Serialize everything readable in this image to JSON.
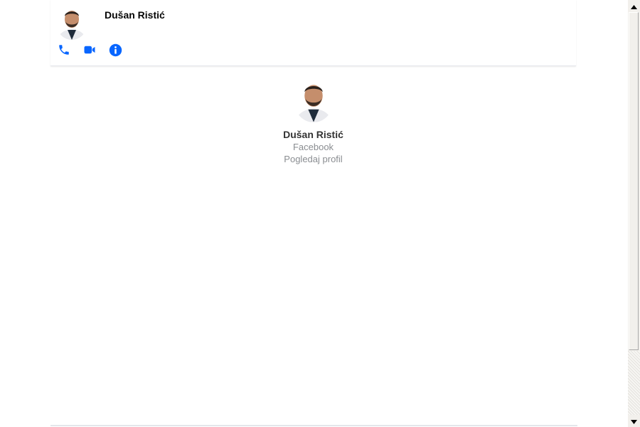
{
  "conversation": {
    "contact_name": "Dušan Ristić"
  },
  "header": {
    "actions": [
      {
        "icon": "phone-icon",
        "color": "#0866ff"
      },
      {
        "icon": "video-camera-icon",
        "color": "#0866ff"
      },
      {
        "icon": "info-icon",
        "color": "#0866ff"
      }
    ]
  },
  "profile": {
    "name": "Dušan Ristić",
    "source": "Facebook",
    "view_profile_label": "Pogledaj profil"
  },
  "colors": {
    "accent": "#0866ff",
    "muted_text": "#8a8d91"
  }
}
